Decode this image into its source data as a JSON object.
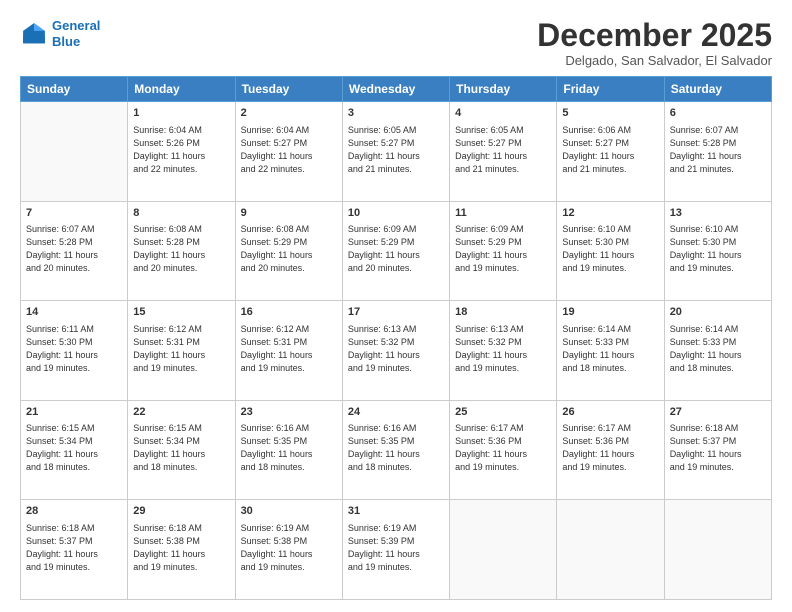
{
  "header": {
    "logo_line1": "General",
    "logo_line2": "Blue",
    "month_title": "December 2025",
    "location": "Delgado, San Salvador, El Salvador"
  },
  "weekdays": [
    "Sunday",
    "Monday",
    "Tuesday",
    "Wednesday",
    "Thursday",
    "Friday",
    "Saturday"
  ],
  "weeks": [
    [
      {
        "day": "",
        "sunrise": "",
        "sunset": "",
        "daylight": ""
      },
      {
        "day": "1",
        "sunrise": "Sunrise: 6:04 AM",
        "sunset": "Sunset: 5:26 PM",
        "daylight": "Daylight: 11 hours and 22 minutes."
      },
      {
        "day": "2",
        "sunrise": "Sunrise: 6:04 AM",
        "sunset": "Sunset: 5:27 PM",
        "daylight": "Daylight: 11 hours and 22 minutes."
      },
      {
        "day": "3",
        "sunrise": "Sunrise: 6:05 AM",
        "sunset": "Sunset: 5:27 PM",
        "daylight": "Daylight: 11 hours and 21 minutes."
      },
      {
        "day": "4",
        "sunrise": "Sunrise: 6:05 AM",
        "sunset": "Sunset: 5:27 PM",
        "daylight": "Daylight: 11 hours and 21 minutes."
      },
      {
        "day": "5",
        "sunrise": "Sunrise: 6:06 AM",
        "sunset": "Sunset: 5:27 PM",
        "daylight": "Daylight: 11 hours and 21 minutes."
      },
      {
        "day": "6",
        "sunrise": "Sunrise: 6:07 AM",
        "sunset": "Sunset: 5:28 PM",
        "daylight": "Daylight: 11 hours and 21 minutes."
      }
    ],
    [
      {
        "day": "7",
        "sunrise": "Sunrise: 6:07 AM",
        "sunset": "Sunset: 5:28 PM",
        "daylight": "Daylight: 11 hours and 20 minutes."
      },
      {
        "day": "8",
        "sunrise": "Sunrise: 6:08 AM",
        "sunset": "Sunset: 5:28 PM",
        "daylight": "Daylight: 11 hours and 20 minutes."
      },
      {
        "day": "9",
        "sunrise": "Sunrise: 6:08 AM",
        "sunset": "Sunset: 5:29 PM",
        "daylight": "Daylight: 11 hours and 20 minutes."
      },
      {
        "day": "10",
        "sunrise": "Sunrise: 6:09 AM",
        "sunset": "Sunset: 5:29 PM",
        "daylight": "Daylight: 11 hours and 20 minutes."
      },
      {
        "day": "11",
        "sunrise": "Sunrise: 6:09 AM",
        "sunset": "Sunset: 5:29 PM",
        "daylight": "Daylight: 11 hours and 19 minutes."
      },
      {
        "day": "12",
        "sunrise": "Sunrise: 6:10 AM",
        "sunset": "Sunset: 5:30 PM",
        "daylight": "Daylight: 11 hours and 19 minutes."
      },
      {
        "day": "13",
        "sunrise": "Sunrise: 6:10 AM",
        "sunset": "Sunset: 5:30 PM",
        "daylight": "Daylight: 11 hours and 19 minutes."
      }
    ],
    [
      {
        "day": "14",
        "sunrise": "Sunrise: 6:11 AM",
        "sunset": "Sunset: 5:30 PM",
        "daylight": "Daylight: 11 hours and 19 minutes."
      },
      {
        "day": "15",
        "sunrise": "Sunrise: 6:12 AM",
        "sunset": "Sunset: 5:31 PM",
        "daylight": "Daylight: 11 hours and 19 minutes."
      },
      {
        "day": "16",
        "sunrise": "Sunrise: 6:12 AM",
        "sunset": "Sunset: 5:31 PM",
        "daylight": "Daylight: 11 hours and 19 minutes."
      },
      {
        "day": "17",
        "sunrise": "Sunrise: 6:13 AM",
        "sunset": "Sunset: 5:32 PM",
        "daylight": "Daylight: 11 hours and 19 minutes."
      },
      {
        "day": "18",
        "sunrise": "Sunrise: 6:13 AM",
        "sunset": "Sunset: 5:32 PM",
        "daylight": "Daylight: 11 hours and 19 minutes."
      },
      {
        "day": "19",
        "sunrise": "Sunrise: 6:14 AM",
        "sunset": "Sunset: 5:33 PM",
        "daylight": "Daylight: 11 hours and 18 minutes."
      },
      {
        "day": "20",
        "sunrise": "Sunrise: 6:14 AM",
        "sunset": "Sunset: 5:33 PM",
        "daylight": "Daylight: 11 hours and 18 minutes."
      }
    ],
    [
      {
        "day": "21",
        "sunrise": "Sunrise: 6:15 AM",
        "sunset": "Sunset: 5:34 PM",
        "daylight": "Daylight: 11 hours and 18 minutes."
      },
      {
        "day": "22",
        "sunrise": "Sunrise: 6:15 AM",
        "sunset": "Sunset: 5:34 PM",
        "daylight": "Daylight: 11 hours and 18 minutes."
      },
      {
        "day": "23",
        "sunrise": "Sunrise: 6:16 AM",
        "sunset": "Sunset: 5:35 PM",
        "daylight": "Daylight: 11 hours and 18 minutes."
      },
      {
        "day": "24",
        "sunrise": "Sunrise: 6:16 AM",
        "sunset": "Sunset: 5:35 PM",
        "daylight": "Daylight: 11 hours and 18 minutes."
      },
      {
        "day": "25",
        "sunrise": "Sunrise: 6:17 AM",
        "sunset": "Sunset: 5:36 PM",
        "daylight": "Daylight: 11 hours and 19 minutes."
      },
      {
        "day": "26",
        "sunrise": "Sunrise: 6:17 AM",
        "sunset": "Sunset: 5:36 PM",
        "daylight": "Daylight: 11 hours and 19 minutes."
      },
      {
        "day": "27",
        "sunrise": "Sunrise: 6:18 AM",
        "sunset": "Sunset: 5:37 PM",
        "daylight": "Daylight: 11 hours and 19 minutes."
      }
    ],
    [
      {
        "day": "28",
        "sunrise": "Sunrise: 6:18 AM",
        "sunset": "Sunset: 5:37 PM",
        "daylight": "Daylight: 11 hours and 19 minutes."
      },
      {
        "day": "29",
        "sunrise": "Sunrise: 6:18 AM",
        "sunset": "Sunset: 5:38 PM",
        "daylight": "Daylight: 11 hours and 19 minutes."
      },
      {
        "day": "30",
        "sunrise": "Sunrise: 6:19 AM",
        "sunset": "Sunset: 5:38 PM",
        "daylight": "Daylight: 11 hours and 19 minutes."
      },
      {
        "day": "31",
        "sunrise": "Sunrise: 6:19 AM",
        "sunset": "Sunset: 5:39 PM",
        "daylight": "Daylight: 11 hours and 19 minutes."
      },
      {
        "day": "",
        "sunrise": "",
        "sunset": "",
        "daylight": ""
      },
      {
        "day": "",
        "sunrise": "",
        "sunset": "",
        "daylight": ""
      },
      {
        "day": "",
        "sunrise": "",
        "sunset": "",
        "daylight": ""
      }
    ]
  ]
}
